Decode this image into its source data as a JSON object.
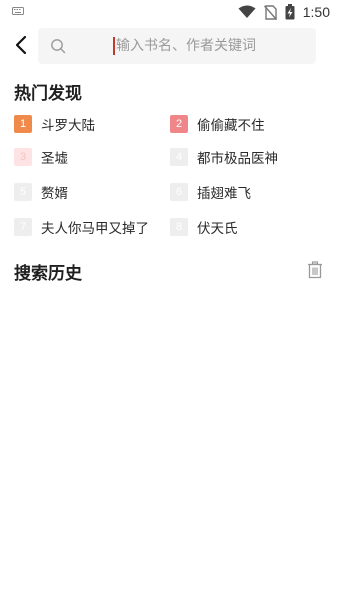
{
  "status_bar": {
    "time": "1:50",
    "icons": [
      "keyboard-icon",
      "wifi-icon",
      "no-sim-icon",
      "battery-charging-icon"
    ]
  },
  "search": {
    "placeholder": "输入书名、作者关键词"
  },
  "hot": {
    "title": "热门发现",
    "items": [
      {
        "rank": "1",
        "label": "斗罗大陆",
        "badge_color": "#f08a4b",
        "rank_color": "#ffffff"
      },
      {
        "rank": "2",
        "label": "偷偷藏不住",
        "badge_color": "#f0868a",
        "rank_color": "#ffffff"
      },
      {
        "rank": "3",
        "label": "圣墟",
        "badge_color": "#fde3e3",
        "rank_color": "#f6c4c4"
      },
      {
        "rank": "4",
        "label": "都市极品医神",
        "badge_color": "#eeeeee",
        "rank_color": "#ffffff"
      },
      {
        "rank": "5",
        "label": "赘婿",
        "badge_color": "#eeeeee",
        "rank_color": "#ffffff"
      },
      {
        "rank": "6",
        "label": "插翅难飞",
        "badge_color": "#eeeeee",
        "rank_color": "#ffffff"
      },
      {
        "rank": "7",
        "label": "夫人你马甲又掉了",
        "badge_color": "#eeeeee",
        "rank_color": "#ffffff"
      },
      {
        "rank": "8",
        "label": "伏天氏",
        "badge_color": "#eeeeee",
        "rank_color": "#ffffff"
      }
    ]
  },
  "history": {
    "title": "搜索历史"
  }
}
